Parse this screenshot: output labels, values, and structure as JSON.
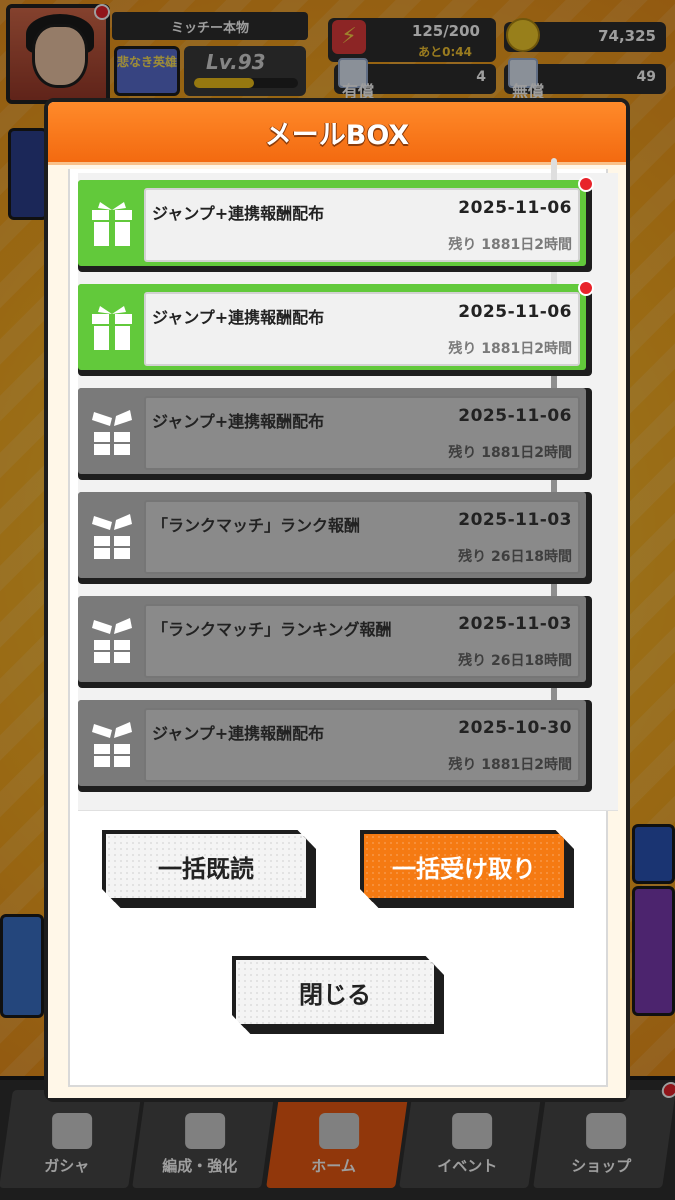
{
  "header": {
    "player_name": "ミッチー本物",
    "title_badge": "悲なき英雄",
    "level": "Lv.93",
    "stamina": "125/200",
    "stamina_timer": "あと0:44",
    "coins": "74,325",
    "paid_gems_label": "有償",
    "paid_gems": "4",
    "free_gems_label": "無償",
    "free_gems": "49"
  },
  "modal": {
    "title": "メールBOX",
    "mails": [
      {
        "title": "ジャンプ+連携報酬配布",
        "date": "2025-11-06",
        "remaining": "残り 1881日2時間",
        "state": "unread"
      },
      {
        "title": "ジャンプ+連携報酬配布",
        "date": "2025-11-06",
        "remaining": "残り 1881日2時間",
        "state": "unread"
      },
      {
        "title": "ジャンプ+連携報酬配布",
        "date": "2025-11-06",
        "remaining": "残り 1881日2時間",
        "state": "received"
      },
      {
        "title": "「ランクマッチ」ランク報酬",
        "date": "2025-11-03",
        "remaining": "残り 26日18時間",
        "state": "received"
      },
      {
        "title": "「ランクマッチ」ランキング報酬",
        "date": "2025-11-03",
        "remaining": "残り 26日18時間",
        "state": "received"
      },
      {
        "title": "ジャンプ+連携報酬配布",
        "date": "2025-10-30",
        "remaining": "残り 1881日2時間",
        "state": "received"
      }
    ],
    "buttons": {
      "mark_all_read": "一括既読",
      "receive_all": "一括受け取り",
      "close": "閉じる"
    }
  },
  "bottom_nav": [
    {
      "label": "ガシャ",
      "icon": "gacha-icon"
    },
    {
      "label": "編成・強化",
      "icon": "team-icon"
    },
    {
      "label": "ホーム",
      "icon": "home-icon"
    },
    {
      "label": "イベント",
      "icon": "event-icon"
    },
    {
      "label": "ショップ",
      "icon": "shop-cart-icon"
    }
  ],
  "colors": {
    "accent_orange": "#f36a10",
    "unread_green": "#62c93b",
    "received_gray": "#7a7a7a",
    "notify_red": "#e8232a"
  }
}
